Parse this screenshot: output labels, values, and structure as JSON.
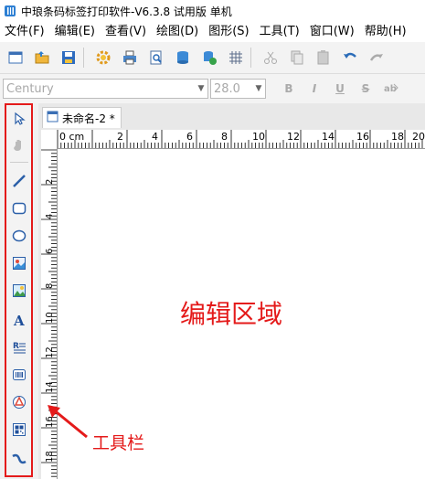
{
  "window": {
    "title": "中琅条码标签打印软件-V6.3.8 试用版 单机"
  },
  "menu": [
    {
      "label": "文件(F)"
    },
    {
      "label": "编辑(E)"
    },
    {
      "label": "查看(V)"
    },
    {
      "label": "绘图(D)"
    },
    {
      "label": "图形(S)"
    },
    {
      "label": "工具(T)"
    },
    {
      "label": "窗口(W)"
    },
    {
      "label": "帮助(H)"
    }
  ],
  "format_bar": {
    "font_family": "Century",
    "font_size": "28.0",
    "bold": "B",
    "italic": "I",
    "underline": "U",
    "strike": "S"
  },
  "document": {
    "tab_label": "未命名-2 *"
  },
  "ruler": {
    "top_unit": "0 cm",
    "top_labels": [
      "2",
      "4",
      "6",
      "8",
      "10",
      "12",
      "14",
      "16",
      "18",
      "20"
    ],
    "left_labels": [
      "2",
      "4",
      "6",
      "8",
      "10",
      "12",
      "14",
      "16",
      "18"
    ]
  },
  "annotations": {
    "canvas_label": "编辑区域",
    "toolbar_label": "工具栏"
  },
  "colors": {
    "highlight": "#e41a1a",
    "accent_blue": "#1f5fb3"
  },
  "icons": {
    "toolbar_top": [
      "new-icon",
      "open-icon",
      "save-icon",
      "settings-icon",
      "print-icon",
      "print-preview-icon",
      "database-icon",
      "database-settings-icon",
      "grid-icon",
      "cut-icon",
      "copy-icon",
      "paste-icon",
      "undo-icon",
      "redo-icon"
    ],
    "toolbar_left": [
      "select-arrow-icon",
      "pan-icon",
      "line-icon",
      "rounded-rectangle-icon",
      "ellipse-icon",
      "image-icon",
      "picture-icon",
      "text-icon",
      "rich-text-icon",
      "barcode-icon",
      "shape-icon",
      "qrcode-icon",
      "curve-icon"
    ]
  }
}
